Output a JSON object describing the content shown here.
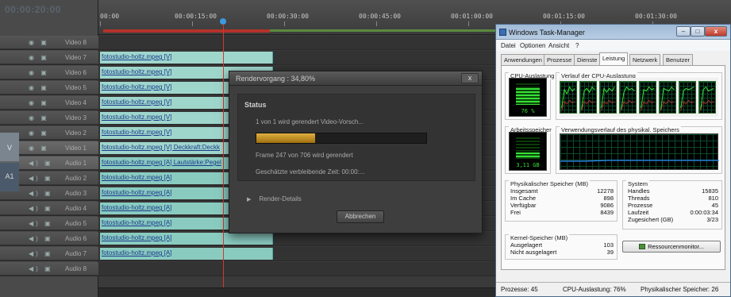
{
  "timeline": {
    "timecode": "00:00:20:00",
    "ruler_labels": [
      "00:00",
      "00:00:15:00",
      "00:00:30:00",
      "00:00:45:00",
      "00:01:00:00",
      "00:01:15:00",
      "00:01:30:00"
    ],
    "clip_label_suffix": "Deckkraft:Deckk",
    "audio_clip_suffix": "Lautstärke:Pegel",
    "side_labels": {
      "video": "V",
      "audio": "A1"
    },
    "tracks": [
      {
        "name": "Video 8",
        "clip": ""
      },
      {
        "name": "Video 7",
        "clip": "fotostudio-holtz.mpeg [V]"
      },
      {
        "name": "Video 6",
        "clip": "fotostudio-holtz.mpeg [V]"
      },
      {
        "name": "Video 5",
        "clip": "fotostudio-holtz.mpeg [V]"
      },
      {
        "name": "Video 4",
        "clip": "fotostudio-holtz.mpeg [V]"
      },
      {
        "name": "Video 3",
        "clip": "fotostudio-holtz.mpeg [V]"
      },
      {
        "name": "Video 2",
        "clip": "fotostudio-holtz.mpeg [V]"
      },
      {
        "name": "Video 1",
        "clip": "fotostudio-holtz.mpeg [V] Deckkraft:Deckk"
      },
      {
        "name": "Audio 1",
        "clip": "fotostudio-holtz.mpeg [A] Lautstärke:Pegel"
      },
      {
        "name": "Audio 2",
        "clip": "fotostudio-holtz.mpeg [A]"
      },
      {
        "name": "Audio 3",
        "clip": "fotostudio-holtz.mpeg [A]"
      },
      {
        "name": "Audio 4",
        "clip": "fotostudio-holtz.mpeg [A]"
      },
      {
        "name": "Audio 5",
        "clip": "fotostudio-holtz.mpeg [A]"
      },
      {
        "name": "Audio 6",
        "clip": "fotostudio-holtz.mpeg [A]"
      },
      {
        "name": "Audio 7",
        "clip": "fotostudio-holtz.mpeg [A]"
      },
      {
        "name": "Audio 8",
        "clip": ""
      }
    ]
  },
  "render_dialog": {
    "title": "Rendervorgang : 34,80%",
    "close_label": "x",
    "status_heading": "Status",
    "status_line": "1 von 1 wird gerendert Video-Vorsch...",
    "progress": 0.348,
    "frame_line": "Frame 247 von 706 wird gerendert",
    "remaining_line": "Geschätzte verbleibende Zeit: 00:00:...",
    "details_label": "Render-Details",
    "abort_label": "Abbrechen"
  },
  "taskmgr": {
    "title": "Windows Task-Manager",
    "min": "–",
    "max": "□",
    "close": "x",
    "menu": [
      "Datei",
      "Optionen",
      "Ansicht",
      "?"
    ],
    "tabs": [
      "Anwendungen",
      "Prozesse",
      "Dienste",
      "Leistung",
      "Netzwerk",
      "Benutzer"
    ],
    "active_tab": "Leistung",
    "cpu_usage_title": "CPU-Auslastung",
    "cpu_history_title": "Verlauf der CPU-Auslastung",
    "cpu_value": "76 %",
    "cpu_fraction": 0.76,
    "mem_title": "Arbeitsspeicher",
    "mem_history_title": "Verwendungsverlauf des physikal. Speichers",
    "mem_value": "3,11 GB",
    "mem_fraction": 0.28,
    "phys_title": "Physikalischer Speicher (MB)",
    "phys_rows": [
      {
        "k": "Insgesamt",
        "v": "12278"
      },
      {
        "k": "Im Cache",
        "v": "898"
      },
      {
        "k": "Verfügbar",
        "v": "9086"
      },
      {
        "k": "Frei",
        "v": "8439"
      }
    ],
    "kernel_title": "Kernel-Speicher (MB)",
    "kernel_rows": [
      {
        "k": "Ausgelagert",
        "v": "103"
      },
      {
        "k": "Nicht ausgelagert",
        "v": "39"
      }
    ],
    "system_title": "System",
    "system_rows": [
      {
        "k": "Handles",
        "v": "15835"
      },
      {
        "k": "Threads",
        "v": "810"
      },
      {
        "k": "Prozesse",
        "v": "45"
      },
      {
        "k": "Laufzeit",
        "v": "0:00:03:34"
      },
      {
        "k": "Zugesichert (GB)",
        "v": "3/23"
      }
    ],
    "resmon_label": "Ressourcenmonitor...",
    "status_processes": "Prozesse: 45",
    "status_cpu": "CPU-Auslastung: 76%",
    "status_mem": "Physikalischer Speicher: 26"
  }
}
